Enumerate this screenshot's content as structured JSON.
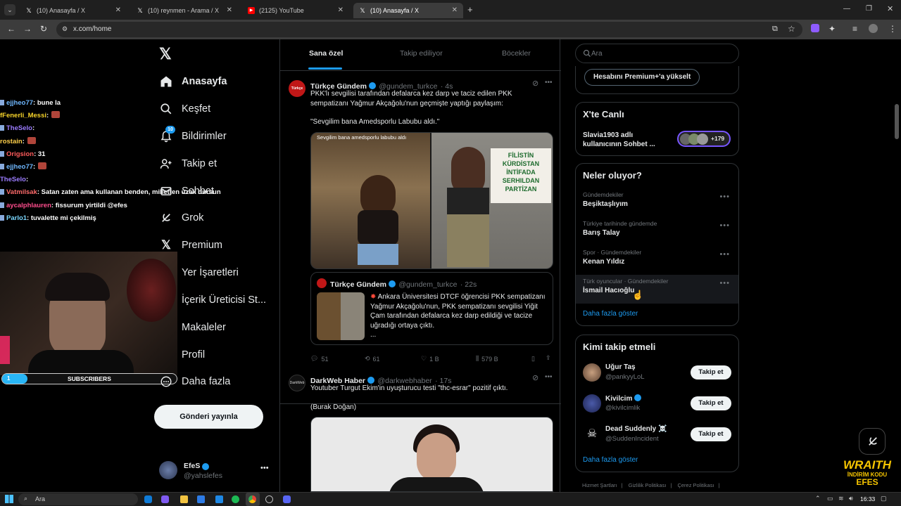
{
  "browser": {
    "tabs": [
      {
        "title": "(10) Anasayfa / X",
        "icon": "x-logo-icon"
      },
      {
        "title": "(10) reynmen - Arama / X",
        "icon": "x-logo-icon"
      },
      {
        "title": "(2125) YouTube",
        "icon": "youtube-icon"
      },
      {
        "title": "(10) Anasayfa / X",
        "icon": "x-logo-icon"
      }
    ],
    "active_tab": 3,
    "url": "x.com/home"
  },
  "chat": {
    "messages": [
      {
        "user": "ejjheo77",
        "text": ": bune la",
        "color": "#6fb8ff"
      },
      {
        "user": "fFenerli_Messi",
        "text": ":",
        "color": "#f7d42a"
      },
      {
        "user": "TheSelo",
        "text": ":",
        "color": "#9b7cff"
      },
      {
        "user": "rostain",
        "text": ":",
        "color": "#ffd04a"
      },
      {
        "user": "Origsion",
        "text": ": 31",
        "color": "#ff5c5c"
      },
      {
        "user": "ejjheo77",
        "text": ":",
        "color": "#6fb8ff"
      },
      {
        "user": "TheSelo",
        "text": ":",
        "color": "#9b7cff"
      },
      {
        "user": "Vatmilsak",
        "text": ": Satan zaten ama kullanan benden, milletten uzak dursun",
        "color": "#ff6b6b"
      },
      {
        "user": "aycalphlauren",
        "text": ": fissurum yirtildi @efes",
        "color": "#ff4d8d"
      },
      {
        "user": "Parlo1",
        "text": ": tuvalette mi çekilmiş",
        "color": "#7ad7ff"
      }
    ],
    "subscribers_label": "SUBSCRIBERS",
    "subscribers_count": "1"
  },
  "sidebar": {
    "items": [
      {
        "label": "Anasayfa",
        "icon": "home-icon",
        "active": true
      },
      {
        "label": "Keşfet",
        "icon": "search-icon"
      },
      {
        "label": "Bildirimler",
        "icon": "bell-icon",
        "badge": "10"
      },
      {
        "label": "Takip et",
        "icon": "add-person-icon"
      },
      {
        "label": "Sohbet",
        "icon": "mail-icon"
      },
      {
        "label": "Grok",
        "icon": "grok-icon"
      },
      {
        "label": "Premium",
        "icon": "x-logo-icon"
      },
      {
        "label": "Yer İşaretleri",
        "icon": "bookmark-icon"
      },
      {
        "label": "İçerik Üreticisi St...",
        "icon": "studio-icon"
      },
      {
        "label": "Makaleler",
        "icon": "article-icon"
      },
      {
        "label": "Profil",
        "icon": "person-icon"
      },
      {
        "label": "Daha fazla",
        "icon": "more-circle-icon"
      }
    ],
    "post_button": "Gönderi yayınla",
    "account": {
      "name": "EfeS",
      "handle": "@yahslefes"
    }
  },
  "feed_tabs": [
    "Sana özel",
    "Takip ediliyor",
    "Böcekler"
  ],
  "posts": [
    {
      "name": "Türkçe Gündem",
      "handle": "@gundem_turkce",
      "time": "· 4s",
      "text": "PKK'lı sevgilisi tarafından defalarca kez darp ve taciz edilen PKK sempatizanı Yağmur Akçağolu'nun geçmişte yaptığı paylaşım:",
      "quote_line": "\"Sevgilim bana Amedsporlu Labubu aldı.\"",
      "image_caption": "Sevgilim bana amedsporlu labubu aldı",
      "sign_text": "FİLİSTİN KÜRDİSTAN İNTİFADA SERHILDAN PARTİZAN",
      "quoted": {
        "name": "Türkçe Gündem",
        "handle": "@gundem_turkce",
        "time": "· 22s",
        "text": "Ankara Üniversitesi DTCF öğrencisi PKK sempatizanı Yağmur Akçağolu'nun, PKK sempatizanı sevgilisi Yiğit Çam tarafından defalarca kez darp edildiği ve tacize uğradığı ortaya çıktı.",
        "more": "..."
      },
      "stats": {
        "replies": "51",
        "reposts": "61",
        "likes": "1 B",
        "views": "579 B"
      }
    },
    {
      "name": "DarkWeb Haber",
      "handle": "@darkwebhaber",
      "time": "· 17s",
      "text": "Youtuber Turgut Ekim'in uyuşturucu testi \"thc-esrar\" pozitif çıktı.",
      "byline": "(Burak Doğan)"
    }
  ],
  "right": {
    "search_placeholder": "Ara",
    "premium_button": "Hesabını Premium+'a yükselt",
    "live": {
      "title": "X'te Canlı",
      "text": "Slavia1903 adlı kullanıcının Sohbet ...",
      "count": "+179"
    },
    "trends": {
      "title": "Neler oluyor?",
      "items": [
        {
          "meta": "Gündemdekiler",
          "title": "Beşiktaşlıyım"
        },
        {
          "meta": "Türkiye tarihinde gündemde",
          "title": "Barış Talay"
        },
        {
          "meta": "Spor · Gündemdekiler",
          "title": "Kenan Yıldız"
        },
        {
          "meta": "Türk oyuncular · Gündemdekiler",
          "title": "İsmail Hacıoğlu"
        }
      ],
      "more": "Daha fazla göster"
    },
    "follow": {
      "title": "Kimi takip etmeli",
      "items": [
        {
          "name": "Uğur Taş",
          "handle": "@pankyyLoL",
          "button": "Takip et"
        },
        {
          "name": "Kivilcim",
          "handle": "@kivilcimlik",
          "button": "Takip et"
        },
        {
          "name": "Dead Suddenly ☠️",
          "handle": "@SuddenIncident",
          "button": "Takip et"
        }
      ],
      "more": "Daha fazla göster"
    },
    "footer": [
      "Hizmet Şartları",
      "Gizlilik Politikası",
      "Çerez Politikası"
    ]
  },
  "overlay": {
    "brand": "WRAITH",
    "sub": "İNDİRİM KODU",
    "code": "EFES"
  },
  "taskbar": {
    "search": "Ara",
    "time": "16:33"
  },
  "colors": {
    "accent": "#1d9bf0",
    "bg": "#000000",
    "border": "#2f3336"
  }
}
